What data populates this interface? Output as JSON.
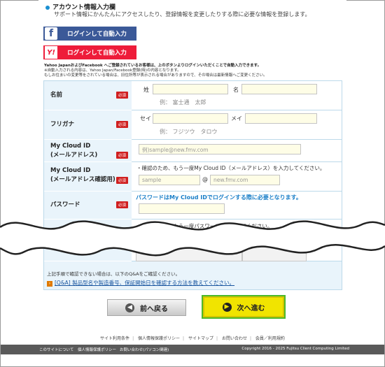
{
  "section": {
    "title": "アカウント情報入力欄",
    "description": "サポート情報にかんたんにアクセスしたり、登録情報を変更したりする際に必要な情報を登録します。"
  },
  "sns": {
    "facebook_label": "ログインして自動入力",
    "facebook_icon": "f",
    "yahoo_label": "ログインして自動入力",
    "yahoo_icon": "Y!"
  },
  "notes": {
    "line1": "Yahoo JapanおよびFacebook へご登録されているお客様は、上のボタンよりログインいただくことで自動入力できます。",
    "line2": "※自動入力される内容は、Yahoo Japan/Facebook登録(時)の内容となります。",
    "line3": "もしお住まいの変更等をされている場合は、旧住所等が表示される場合がありますので、その場合は最新情報へご変更ください。"
  },
  "form": {
    "required_badge": "必須",
    "name": {
      "label": "名前",
      "sei_label": "姓",
      "mei_label": "名",
      "example": "例： 富士通　太郎"
    },
    "furigana": {
      "label": "フリガナ",
      "sei_label": "セイ",
      "mei_label": "メイ",
      "example": "例： フジツウ　タロウ"
    },
    "email": {
      "label_line1": "My Cloud ID",
      "label_line2": "(メールアドレス)",
      "placeholder": "例)sample@new.fmv.com"
    },
    "email_confirm": {
      "label_line1": "My Cloud ID",
      "label_line2": "(メールアドレス確認用)",
      "instruction": "・確認のため、もう一度My Cloud ID（メールアドレス）を入力してください。",
      "local_placeholder": "sample",
      "at": "@",
      "domain_placeholder": "new.fmv.com"
    },
    "password": {
      "label": "パスワード",
      "notice": "パスワードはMy Cloud IDでログインする際に必要となります。"
    },
    "password_confirm": {
      "instruction": "・確認のため、もう一度パスワードを入力してください。"
    }
  },
  "after": {
    "check_text": "上記手順で確認できない場合は、以下のQ&Aをご確認ください。",
    "faq_link": "[Q&A] 製品型名や製造番号、保証開始日を確認する方法を教えてください。"
  },
  "buttons": {
    "back": "前へ戻る",
    "next": "次へ進む"
  },
  "footer": {
    "links": [
      "サイト利用条件",
      "個人情報保護ポリシー",
      "サイトマップ",
      "お問い合わせ",
      "会員／利用規約"
    ],
    "bottom_links": [
      "このサイトについて",
      "個人情報保護ポリシー",
      "お問い合わせ(パソコン関連)"
    ],
    "copyright": "Copyright 2016 - 2025 Fujitsu Client Computing Limited"
  },
  "colors": {
    "facebook": "#3b5998",
    "yahoo": "#ee1c3a",
    "required": "#d02020",
    "next_button": "#f1e400",
    "highlight": "#4cb82a"
  }
}
